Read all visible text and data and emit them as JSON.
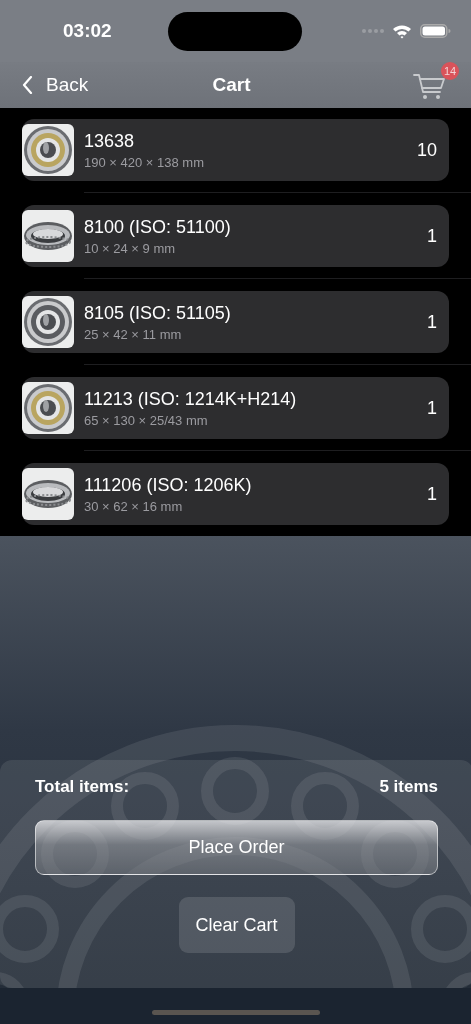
{
  "status_bar": {
    "time": "03:02"
  },
  "nav": {
    "back": "Back",
    "title": "Cart",
    "cart_badge": "14"
  },
  "items": [
    {
      "name": "13638",
      "dimensions": "190 × 420 × 138 mm",
      "quantity": "10"
    },
    {
      "name": "8100 (ISO: 51100)",
      "dimensions": "10 × 24 × 9 mm",
      "quantity": "1"
    },
    {
      "name": "8105 (ISO: 51105)",
      "dimensions": "25 × 42 × 11 mm",
      "quantity": "1"
    },
    {
      "name": "11213 (ISO: 1214K+H214)",
      "dimensions": "65 × 130 × 25/43 mm",
      "quantity": "1"
    },
    {
      "name": "111206 (ISO: 1206K)",
      "dimensions": "30 × 62 × 16 mm",
      "quantity": "1"
    }
  ],
  "summary": {
    "label": "Total items:",
    "value": "5 items"
  },
  "buttons": [
    {
      "label": "Place Order",
      "kind": "primary"
    },
    {
      "label": "Clear Cart",
      "kind": "secondary"
    }
  ]
}
